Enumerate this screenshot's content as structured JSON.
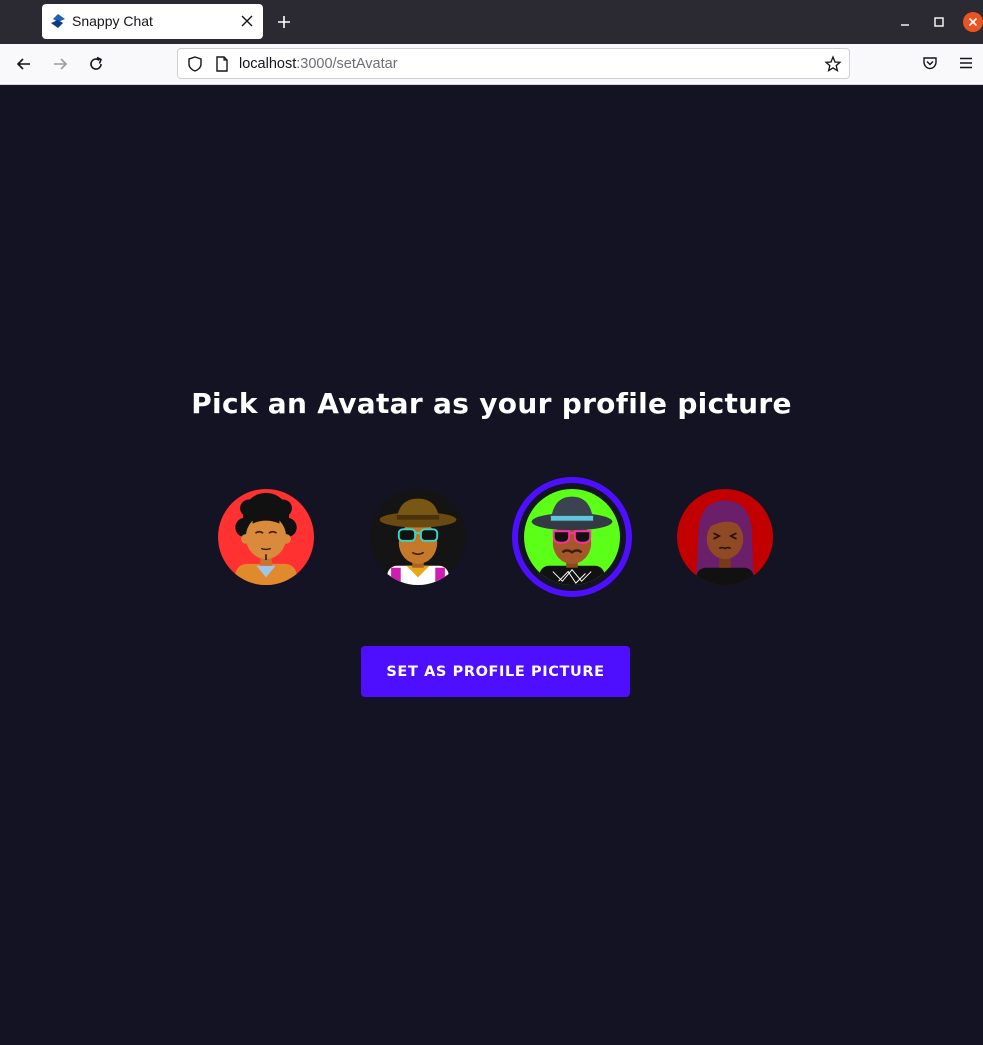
{
  "browser": {
    "tab_title": "Snappy Chat",
    "url_host": "localhost",
    "url_rest": ":3000/setAvatar",
    "icons": {
      "favicon": "snappy-logo-icon",
      "tab_close": "close-icon",
      "new_tab": "plus-icon",
      "back": "arrow-left-icon",
      "forward": "arrow-right-icon",
      "reload": "reload-icon",
      "shield": "shield-icon",
      "page": "page-icon",
      "bookmark": "star-icon",
      "pocket": "pocket-icon",
      "menu": "hamburger-menu-icon"
    }
  },
  "page": {
    "title": "Pick an Avatar as your profile picture",
    "button_label": "SET AS PROFILE PICTURE",
    "avatars": [
      {
        "id": "avatar-1",
        "background": "#ff3131",
        "selected": false
      },
      {
        "id": "avatar-2",
        "background": "#141414",
        "selected": false
      },
      {
        "id": "avatar-3",
        "background": "#5cff17",
        "selected": true
      },
      {
        "id": "avatar-4",
        "background": "#c20000",
        "selected": false
      }
    ]
  },
  "colors": {
    "page_background": "#131324",
    "accent": "#4e0eff",
    "text": "#ffffff"
  }
}
